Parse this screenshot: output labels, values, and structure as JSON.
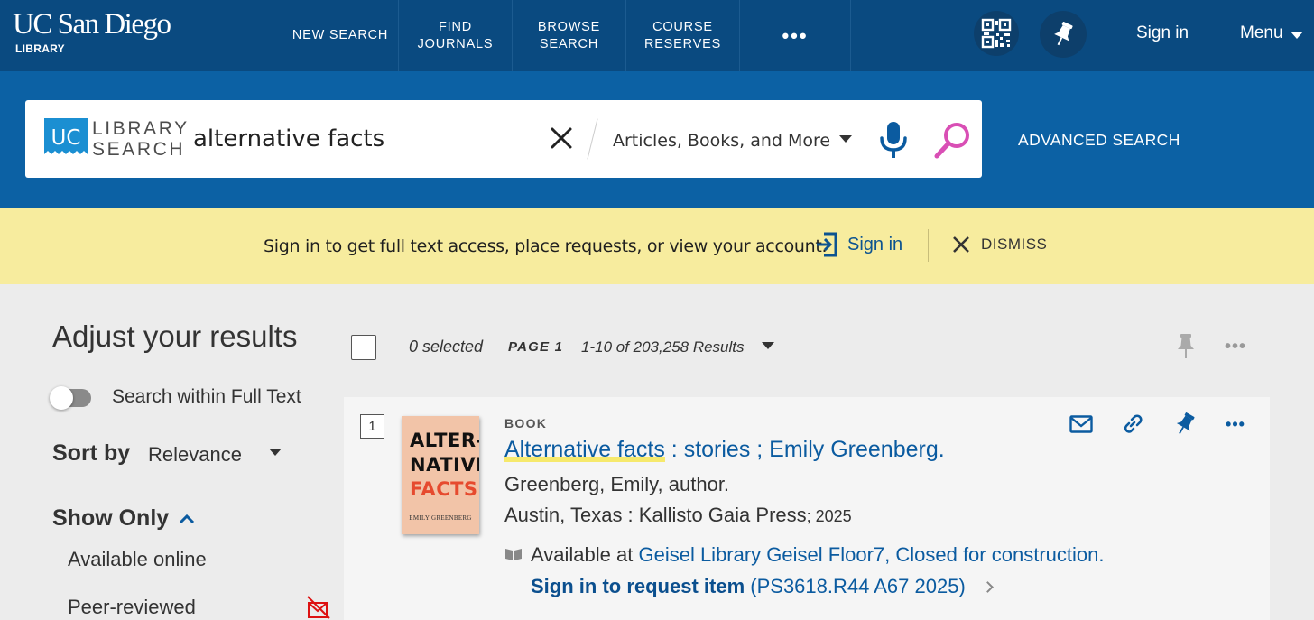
{
  "header": {
    "logo_main": "UC San Diego",
    "logo_sub": "LIBRARY",
    "nav": [
      {
        "line1": "NEW SEARCH",
        "line2": ""
      },
      {
        "line1": "FIND",
        "line2": "JOURNALS"
      },
      {
        "line1": "BROWSE",
        "line2": "SEARCH"
      },
      {
        "line1": "COURSE",
        "line2": "RESERVES"
      }
    ],
    "more": "•••",
    "sign_in": "Sign in",
    "menu": "Menu"
  },
  "search": {
    "badge": "UC",
    "brand_line1": "LIBRARY",
    "brand_line2": "SEARCH",
    "query": "alternative facts",
    "scope": "Articles, Books, and More",
    "advanced": "ADVANCED SEARCH"
  },
  "banner": {
    "message": "Sign in to get full text access, place requests, or view your account.",
    "sign_in": "Sign in",
    "dismiss": "DISMISS"
  },
  "facets": {
    "title": "Adjust your results",
    "full_text_toggle": "Search within Full Text",
    "full_text_on": false,
    "sort_label": "Sort by",
    "sort_value": "Relevance",
    "show_only_label": "Show Only",
    "show_only_items": [
      "Available online",
      "Peer-reviewed"
    ]
  },
  "toolbar": {
    "selected": "0 selected",
    "page": "PAGE 1",
    "results": "1-10 of 203,258 Results"
  },
  "results": [
    {
      "rank": "1",
      "type": "BOOK",
      "title_main": "Alternative facts",
      "title_rest": " : stories ; Emily Greenberg.",
      "author": "Greenberg, Emily, author.",
      "publisher": "Austin, Texas : Kallisto Gaia Press",
      "year": "; 2025",
      "available_prefix": "Available at",
      "available_location": "Geisel Library  Geisel Floor7, Closed for construction.",
      "request_label": "Sign in to request item",
      "call_number": "(PS3618.R44 A67 2025)",
      "cover": {
        "line1": "ALTER-",
        "line2": "NATIVE",
        "line3": "FACTS",
        "author": "EMILY GREENBERG"
      }
    }
  ],
  "colors": {
    "nav_bg": "#0a4a80",
    "search_band": "#0c61a4",
    "banner_bg": "#f7ec9e",
    "link": "#0b5ba0",
    "search_icon": "#d94fb5",
    "title_highlight": "#f6e96c"
  },
  "icons": [
    "qr-code-icon",
    "pin-icon",
    "close-icon",
    "microphone-icon",
    "search-icon",
    "sign-in-icon",
    "email-icon",
    "link-icon",
    "more-icon",
    "book-icon",
    "chevron-up-icon"
  ]
}
